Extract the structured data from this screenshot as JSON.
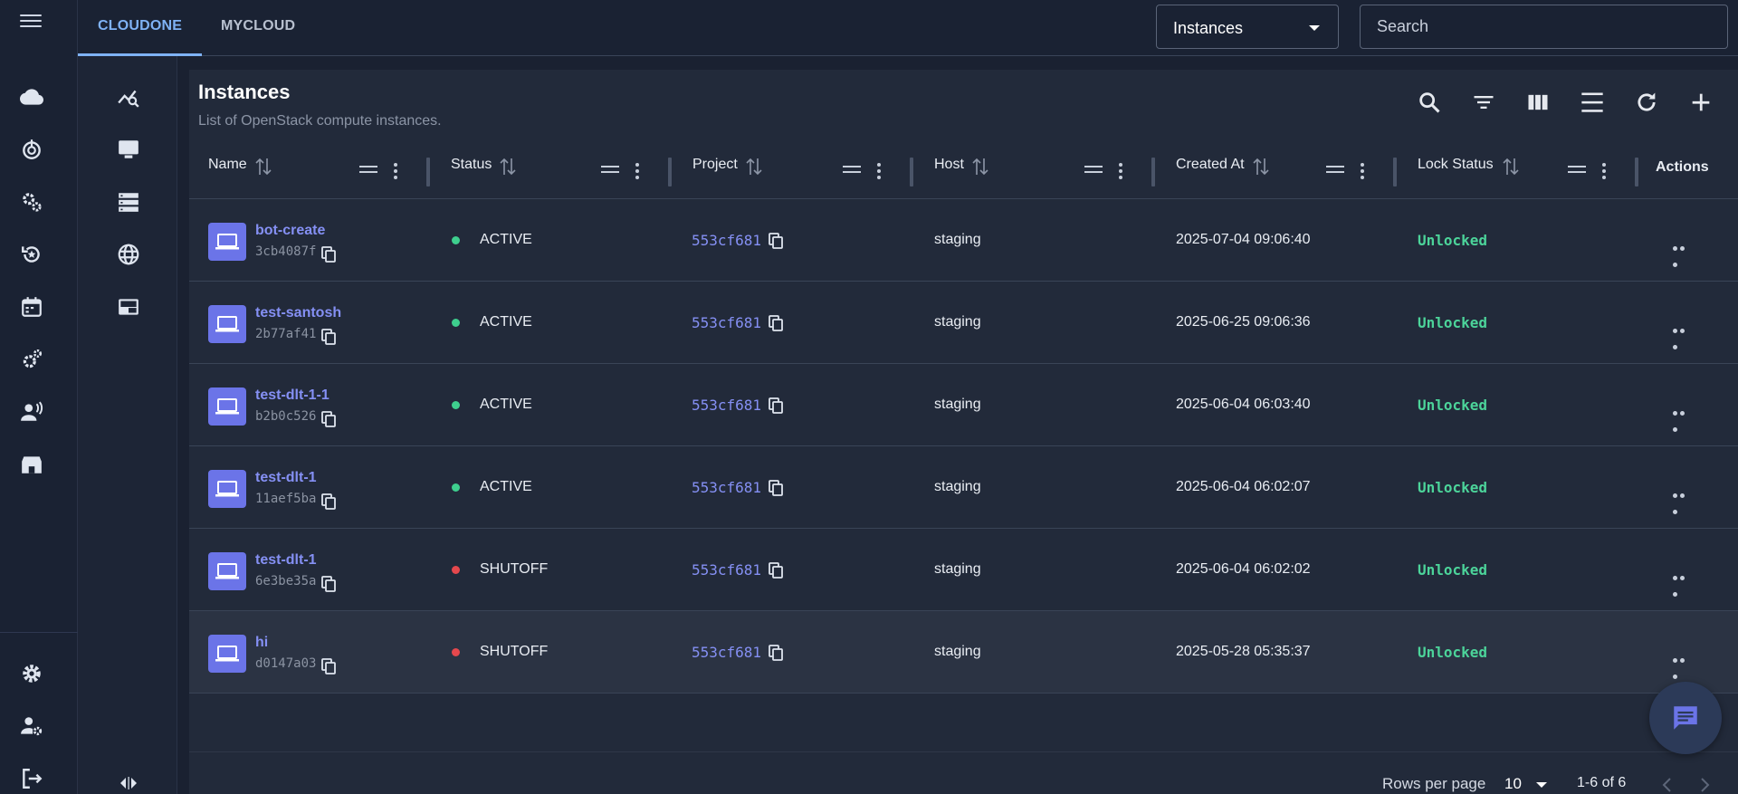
{
  "topbar": {
    "tabs": [
      {
        "label": "CLOUDONE",
        "active": true
      },
      {
        "label": "MYCLOUD",
        "active": false
      }
    ],
    "resource_select": "Instances",
    "search_placeholder": "Search"
  },
  "rail_icons": [
    "cloud-icon",
    "power-icon",
    "services-icon",
    "restore-icon",
    "calendar-icon",
    "config-icon",
    "support-icon",
    "store-icon",
    "settings-icon",
    "user-settings-icon",
    "logout-icon"
  ],
  "subrail_icons": [
    "monitoring-icon",
    "instances-icon",
    "storage-icon",
    "network-icon",
    "images-icon",
    "collapse-toggle-icon"
  ],
  "panel": {
    "title": "Instances",
    "subtitle": "List of OpenStack compute instances.",
    "tools": [
      "search-icon",
      "filter-icon",
      "columns-icon",
      "density-icon",
      "refresh-icon",
      "add-icon"
    ]
  },
  "columns": [
    "Name",
    "Status",
    "Project",
    "Host",
    "Created At",
    "Lock Status",
    "Actions"
  ],
  "rows": [
    {
      "name": "bot-create",
      "id": "3cb4087f",
      "status": "ACTIVE",
      "status_color": "#3ecf8e",
      "project": "553cf681",
      "host": "staging",
      "created": "2025-07-04 09:06:40",
      "lock": "Unlocked"
    },
    {
      "name": "test-santosh",
      "id": "2b77af41",
      "status": "ACTIVE",
      "status_color": "#3ecf8e",
      "project": "553cf681",
      "host": "staging",
      "created": "2025-06-25 09:06:36",
      "lock": "Unlocked"
    },
    {
      "name": "test-dlt-1-1",
      "id": "b2b0c526",
      "status": "ACTIVE",
      "status_color": "#3ecf8e",
      "project": "553cf681",
      "host": "staging",
      "created": "2025-06-04 06:03:40",
      "lock": "Unlocked"
    },
    {
      "name": "test-dlt-1",
      "id": "11aef5ba",
      "status": "ACTIVE",
      "status_color": "#3ecf8e",
      "project": "553cf681",
      "host": "staging",
      "created": "2025-06-04 06:02:07",
      "lock": "Unlocked"
    },
    {
      "name": "test-dlt-1",
      "id": "6e3be35a",
      "status": "SHUTOFF",
      "status_color": "#e5484d",
      "project": "553cf681",
      "host": "staging",
      "created": "2025-06-04 06:02:02",
      "lock": "Unlocked"
    },
    {
      "name": "hi",
      "id": "d0147a03",
      "status": "SHUTOFF",
      "status_color": "#e5484d",
      "project": "553cf681",
      "host": "staging",
      "created": "2025-05-28 05:35:37",
      "lock": "Unlocked"
    }
  ],
  "footer": {
    "rows_per_page_label": "Rows per page",
    "rows_per_page": "10",
    "range": "1-6 of 6"
  },
  "colors": {
    "accent": "#7fb2f5",
    "link": "#8590f4",
    "unlocked": "#4cd49a",
    "active": "#3ecf8e",
    "shutoff": "#e5484d"
  }
}
